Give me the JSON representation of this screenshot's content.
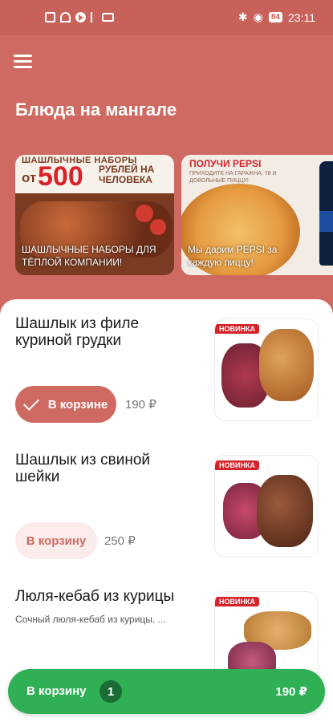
{
  "status_bar": {
    "time": "23:11",
    "battery": "84",
    "left_icons": [
      "sim-icon",
      "wifi-icon",
      "play-icon",
      "usb-icon",
      "mail-icon"
    ],
    "right_icons": [
      "bluetooth-icon",
      "location-icon",
      "battery-icon"
    ]
  },
  "header": {
    "title": "Блюда на мангале",
    "menu_icon": "hamburger-menu-icon"
  },
  "banners": [
    {
      "headline": "ШАШЛЫЧНЫЕ НАБОРЫ",
      "prefix": "от",
      "amount": "500",
      "suffix": "РУБЛЕЙ НА ЧЕЛОВЕКА",
      "caption": "ШАШЛЫЧНЫЕ НАБОРЫ ДЛЯ ТЁПЛОЙ КОМПАНИИ!"
    },
    {
      "headline": "ПОЛУЧИ PEPSI",
      "subtext": "ПРИХОДИТЕ НА ГАРАЖНА, 78 И ДОВОЛЬНЫЕ ПИЦЦУ!",
      "caption": "Мы дарим PEPSI за каждую пиццу!"
    }
  ],
  "products": [
    {
      "name": "Шашлык из филе куриной грудки",
      "description": "",
      "button_label": "В корзине",
      "in_cart": true,
      "price": "190 ₽",
      "image_tag": "НОВИНКА"
    },
    {
      "name": "Шашлык из свиной шейки",
      "description": "",
      "button_label": "В корзину",
      "in_cart": false,
      "price": "250 ₽",
      "image_tag": "НОВИНКА"
    },
    {
      "name": "Люля-кебаб из курицы",
      "description": "Сочный люля-кебаб из курицы. ...",
      "image_tag": "НОВИНКА"
    }
  ],
  "cart_bar": {
    "label": "В корзину",
    "count": "1",
    "total": "190 ₽"
  },
  "colors": {
    "header_bg": "#cf6a63",
    "accent": "#cf6a63",
    "cart_bar": "#2fb055"
  }
}
